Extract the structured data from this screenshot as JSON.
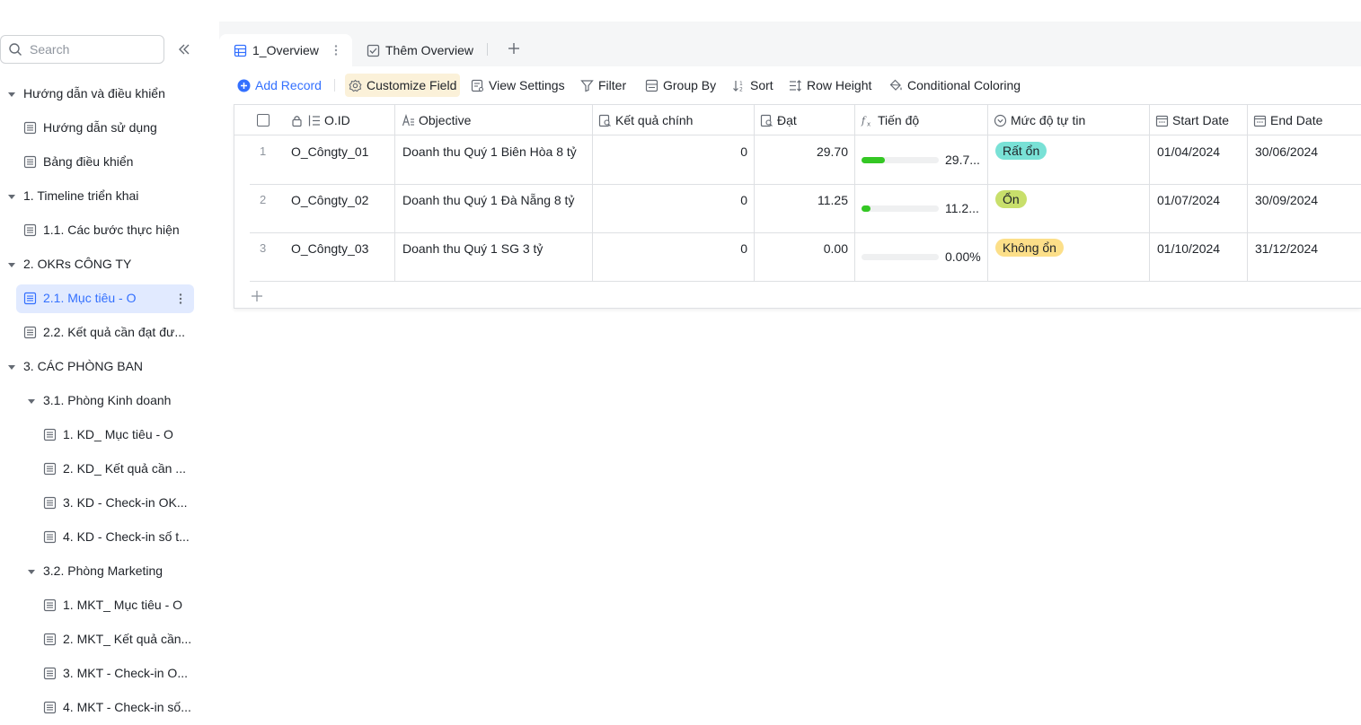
{
  "sidebar": {
    "search_placeholder": "Search",
    "items": [
      {
        "label": "Hướng dẫn và điều khiển"
      },
      {
        "label": "Hướng dẫn sử dụng"
      },
      {
        "label": "Bảng điều khiển"
      },
      {
        "label": "1. Timeline triển khai"
      },
      {
        "label": "1.1. Các bước thực hiện"
      },
      {
        "label": "2. OKRs CÔNG TY"
      },
      {
        "label": "2.1. Mục tiêu - O"
      },
      {
        "label": "2.2. Kết quả cần đạt đư..."
      },
      {
        "label": "3. CÁC PHÒNG BAN"
      },
      {
        "label": "3.1. Phòng Kinh doanh"
      },
      {
        "label": "1. KD_ Mục tiêu - O"
      },
      {
        "label": "2. KD_ Kết quả cần ..."
      },
      {
        "label": "3. KD - Check-in OK..."
      },
      {
        "label": "4. KD - Check-in số t..."
      },
      {
        "label": "3.2. Phòng Marketing"
      },
      {
        "label": "1. MKT_ Mục tiêu - O"
      },
      {
        "label": "2. MKT_ Kết quả cần..."
      },
      {
        "label": "3. MKT - Check-in O..."
      },
      {
        "label": "4. MKT - Check-in số..."
      }
    ]
  },
  "tabs": [
    {
      "label": "1_Overview"
    },
    {
      "label": "Thêm Overview"
    }
  ],
  "toolbar": {
    "add_record": "Add Record",
    "customize_field": "Customize Field",
    "view_settings": "View Settings",
    "filter": "Filter",
    "group_by": "Group By",
    "sort": "Sort",
    "row_height": "Row Height",
    "conditional_coloring": "Conditional Coloring"
  },
  "table": {
    "columns": [
      "O.ID",
      "Objective",
      "Kết quả chính",
      "Đạt",
      "Tiến độ",
      "Mức độ tự tin",
      "Start Date",
      "End Date"
    ],
    "rows": [
      {
        "num": "1",
        "oid": "O_Côngty_01",
        "objective": "Doanh thu Quý 1 Biên Hòa 8 tỷ",
        "kqc": "0",
        "dat": "29.70",
        "progress": 0.297,
        "progress_label": "29.7...",
        "confidence": "Rất ổn",
        "confidence_color": "#79e1d6",
        "start": "01/04/2024",
        "end": "30/06/2024"
      },
      {
        "num": "2",
        "oid": "O_Côngty_02",
        "objective": "Doanh thu Quý 1 Đà Nẵng 8 tỷ",
        "kqc": "0",
        "dat": "11.25",
        "progress": 0.1125,
        "progress_label": "11.2...",
        "confidence": "Ổn",
        "confidence_color": "#c8df6b",
        "start": "01/07/2024",
        "end": "30/09/2024"
      },
      {
        "num": "3",
        "oid": "O_Côngty_03",
        "objective": "Doanh thu Quý 1 SG 3 tỷ",
        "kqc": "0",
        "dat": "0.00",
        "progress": 0.0,
        "progress_label": "0.00%",
        "confidence": "Không ổn",
        "confidence_color": "#fcdf89",
        "start": "01/10/2024",
        "end": "31/12/2024"
      }
    ]
  },
  "colors": {
    "accent": "#3370ff",
    "progress_fill": "#34c724"
  }
}
